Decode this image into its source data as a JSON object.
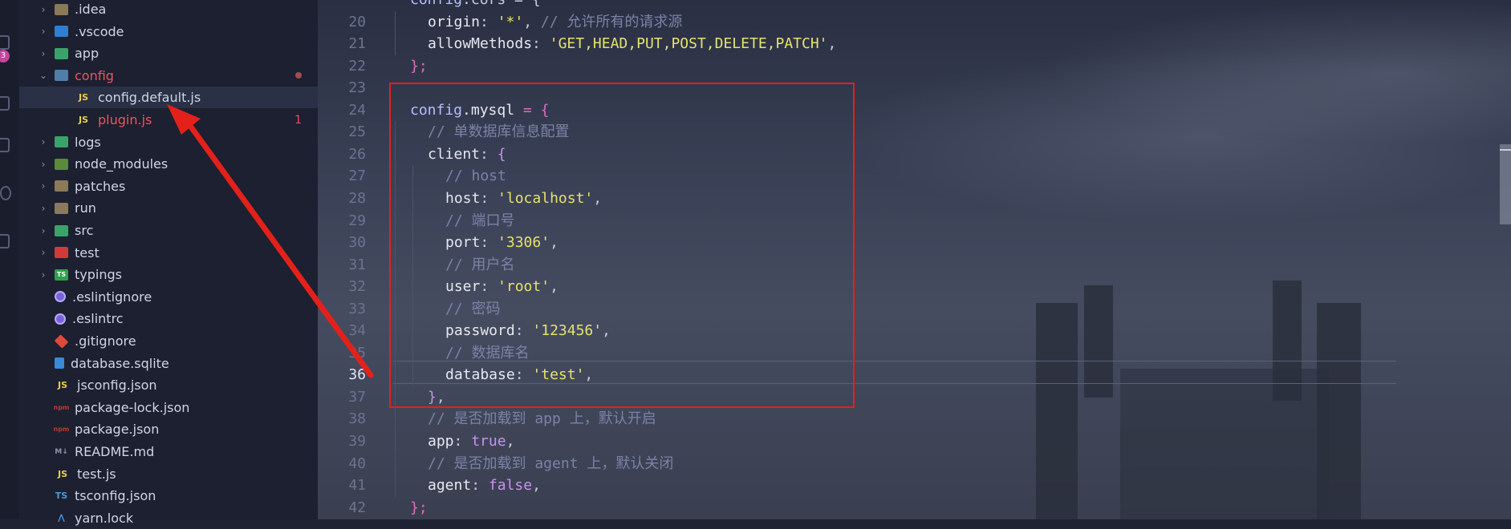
{
  "activity_bar": {
    "badge": "3"
  },
  "explorer": {
    "items": [
      {
        "name": ".idea",
        "type": "folder",
        "icon": "idea-folder-icon",
        "color": "#8a7a5a",
        "expanded": false
      },
      {
        "name": ".vscode",
        "type": "folder",
        "icon": "vscode-folder-icon",
        "color": "#2e7fd1",
        "expanded": false
      },
      {
        "name": "app",
        "type": "folder",
        "icon": "app-folder-icon",
        "color": "#3aa36a",
        "expanded": false
      },
      {
        "name": "config",
        "type": "folder",
        "icon": "config-folder-icon",
        "color": "#4e7fa8",
        "expanded": true,
        "status": "error"
      },
      {
        "name": "config.default.js",
        "type": "file",
        "icon": "js-file-icon",
        "active": true
      },
      {
        "name": "plugin.js",
        "type": "file",
        "icon": "js-file-icon",
        "status": "error",
        "errors": "1"
      },
      {
        "name": "logs",
        "type": "folder",
        "icon": "logs-folder-icon",
        "color": "#3aa36a",
        "expanded": false
      },
      {
        "name": "node_modules",
        "type": "folder",
        "icon": "node-modules-folder-icon",
        "color": "#5a8a3a",
        "expanded": false
      },
      {
        "name": "patches",
        "type": "folder",
        "icon": "folder-icon",
        "color": "#8a7a5a",
        "expanded": false
      },
      {
        "name": "run",
        "type": "folder",
        "icon": "folder-icon",
        "color": "#8a7a5a",
        "expanded": false
      },
      {
        "name": "src",
        "type": "folder",
        "icon": "src-folder-icon",
        "color": "#3aa36a",
        "expanded": false
      },
      {
        "name": "test",
        "type": "folder",
        "icon": "test-folder-icon",
        "color": "#d23a3a",
        "expanded": false
      },
      {
        "name": "typings",
        "type": "folder",
        "icon": "typings-folder-icon",
        "color": "#2fa04a",
        "expanded": false
      },
      {
        "name": ".eslintignore",
        "type": "file",
        "icon": "eslint-icon"
      },
      {
        "name": ".eslintrc",
        "type": "file",
        "icon": "eslint-icon"
      },
      {
        "name": ".gitignore",
        "type": "file",
        "icon": "git-icon"
      },
      {
        "name": "database.sqlite",
        "type": "file",
        "icon": "database-icon"
      },
      {
        "name": "jsconfig.json",
        "type": "file",
        "icon": "json-config-icon"
      },
      {
        "name": "package-lock.json",
        "type": "file",
        "icon": "npm-icon"
      },
      {
        "name": "package.json",
        "type": "file",
        "icon": "npm-icon"
      },
      {
        "name": "README.md",
        "type": "file",
        "icon": "markdown-icon"
      },
      {
        "name": "test.js",
        "type": "file",
        "icon": "js-file-icon"
      },
      {
        "name": "tsconfig.json",
        "type": "file",
        "icon": "ts-config-icon"
      },
      {
        "name": "yarn.lock",
        "type": "file",
        "icon": "yarn-icon"
      }
    ]
  },
  "editor": {
    "current_line": "36",
    "lines": [
      {
        "n": "",
        "indent": 1,
        "tokens": [
          [
            "config",
            "obj"
          ],
          [
            ".cors = {",
            "punc"
          ]
        ]
      },
      {
        "n": "20",
        "indent": 2,
        "tokens": [
          [
            "origin",
            "key"
          ],
          [
            ": ",
            "punc"
          ],
          [
            "'*'",
            "str"
          ],
          [
            ", ",
            "punc"
          ],
          [
            "// 允许所有的请求源",
            "cmt"
          ]
        ]
      },
      {
        "n": "21",
        "indent": 2,
        "tokens": [
          [
            "allowMethods",
            "key"
          ],
          [
            ": ",
            "punc"
          ],
          [
            "'GET,HEAD,PUT,POST,DELETE,PATCH'",
            "str"
          ],
          [
            ",",
            "punc"
          ]
        ]
      },
      {
        "n": "22",
        "indent": 1,
        "tokens": [
          [
            "};",
            "op"
          ]
        ]
      },
      {
        "n": "23",
        "indent": 0,
        "tokens": []
      },
      {
        "n": "24",
        "indent": 1,
        "tokens": [
          [
            "config",
            "obj"
          ],
          [
            ".mysql ",
            "key"
          ],
          [
            "= {",
            "op"
          ]
        ]
      },
      {
        "n": "25",
        "indent": 2,
        "tokens": [
          [
            "// 单数据库信息配置",
            "cmt"
          ]
        ]
      },
      {
        "n": "26",
        "indent": 2,
        "tokens": [
          [
            "client",
            "key"
          ],
          [
            ": ",
            "punc"
          ],
          [
            "{",
            "kw"
          ]
        ]
      },
      {
        "n": "27",
        "indent": 3,
        "tokens": [
          [
            "// host",
            "cmt"
          ]
        ]
      },
      {
        "n": "28",
        "indent": 3,
        "tokens": [
          [
            "host",
            "key"
          ],
          [
            ": ",
            "punc"
          ],
          [
            "'localhost'",
            "str"
          ],
          [
            ",",
            "punc"
          ]
        ]
      },
      {
        "n": "29",
        "indent": 3,
        "tokens": [
          [
            "// 端口号",
            "cmt"
          ]
        ]
      },
      {
        "n": "30",
        "indent": 3,
        "tokens": [
          [
            "port",
            "key"
          ],
          [
            ": ",
            "punc"
          ],
          [
            "'3306'",
            "str"
          ],
          [
            ",",
            "punc"
          ]
        ]
      },
      {
        "n": "31",
        "indent": 3,
        "tokens": [
          [
            "// 用户名",
            "cmt"
          ]
        ]
      },
      {
        "n": "32",
        "indent": 3,
        "tokens": [
          [
            "user",
            "key"
          ],
          [
            ": ",
            "punc"
          ],
          [
            "'root'",
            "str"
          ],
          [
            ",",
            "punc"
          ]
        ]
      },
      {
        "n": "33",
        "indent": 3,
        "tokens": [
          [
            "// 密码",
            "cmt"
          ]
        ]
      },
      {
        "n": "34",
        "indent": 3,
        "tokens": [
          [
            "password",
            "key"
          ],
          [
            ": ",
            "punc"
          ],
          [
            "'123456'",
            "str"
          ],
          [
            ",",
            "punc"
          ]
        ]
      },
      {
        "n": "35",
        "indent": 3,
        "tokens": [
          [
            "// 数据库名",
            "cmt"
          ]
        ]
      },
      {
        "n": "36",
        "indent": 3,
        "tokens": [
          [
            "database",
            "key"
          ],
          [
            ": ",
            "punc"
          ],
          [
            "'test'",
            "str"
          ],
          [
            ",",
            "punc"
          ]
        ]
      },
      {
        "n": "37",
        "indent": 2,
        "tokens": [
          [
            "}",
            "kw"
          ],
          [
            ",",
            "punc"
          ]
        ]
      },
      {
        "n": "38",
        "indent": 2,
        "tokens": [
          [
            "// 是否加载到 app 上，默认开启",
            "cmt"
          ]
        ]
      },
      {
        "n": "39",
        "indent": 2,
        "tokens": [
          [
            "app",
            "key"
          ],
          [
            ": ",
            "punc"
          ],
          [
            "true",
            "bool"
          ],
          [
            ",",
            "punc"
          ]
        ]
      },
      {
        "n": "40",
        "indent": 2,
        "tokens": [
          [
            "// 是否加载到 agent 上，默认关闭",
            "cmt"
          ]
        ]
      },
      {
        "n": "41",
        "indent": 2,
        "tokens": [
          [
            "agent",
            "key"
          ],
          [
            ": ",
            "punc"
          ],
          [
            "false",
            "bool"
          ],
          [
            ",",
            "punc"
          ]
        ]
      },
      {
        "n": "42",
        "indent": 1,
        "tokens": [
          [
            "};",
            "op"
          ]
        ]
      }
    ]
  },
  "annotation": {
    "color": "#e3211a"
  }
}
